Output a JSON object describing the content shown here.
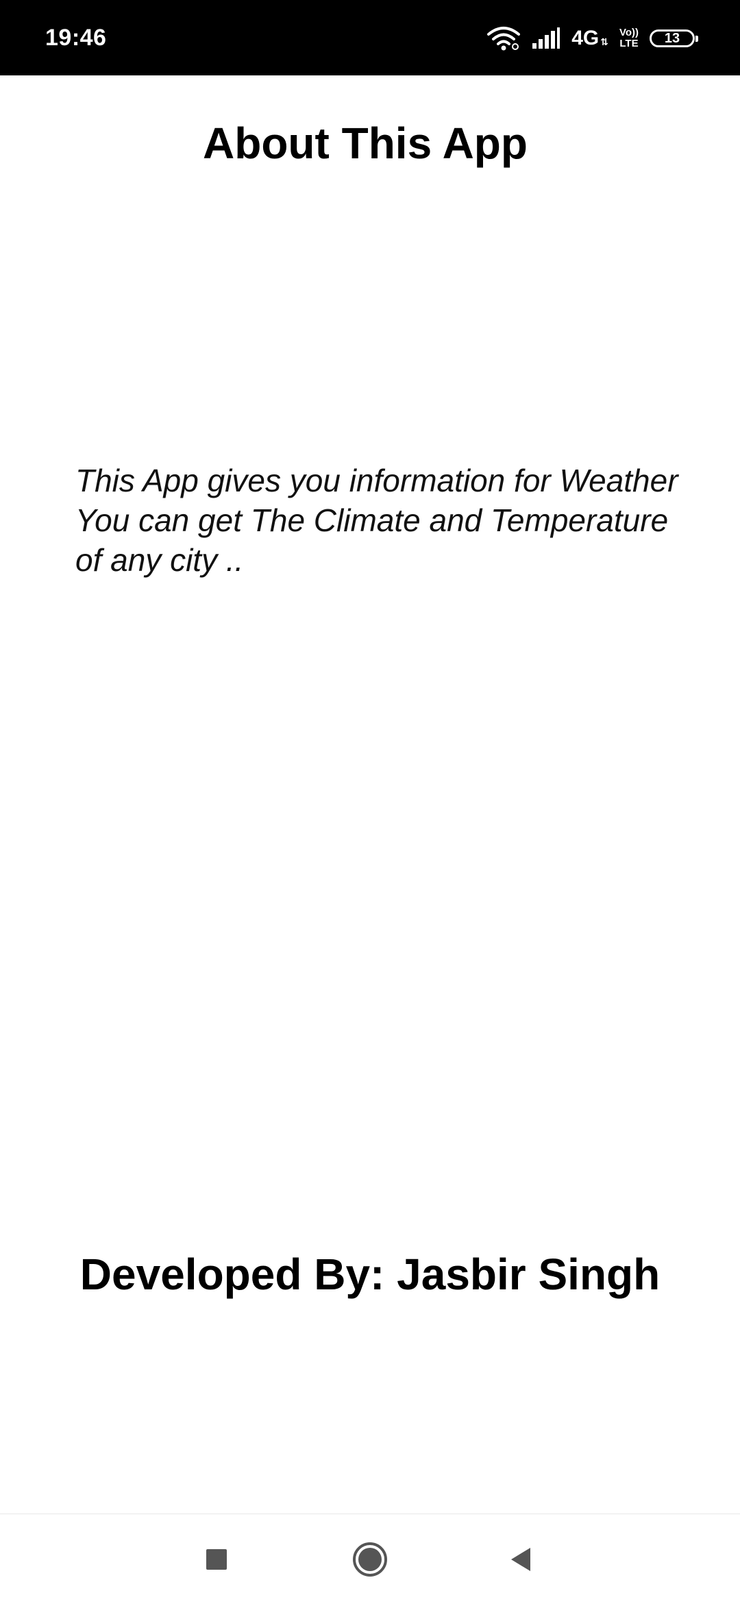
{
  "status_bar": {
    "time": "19:46",
    "network_type": "4G",
    "volte_top": "Vo))",
    "volte_bottom": "LTE",
    "battery_level": "13",
    "icons": [
      "wifi-icon",
      "signal-icon",
      "battery-icon"
    ]
  },
  "about": {
    "title": "About This App",
    "description": "This App gives you information for Weather You can get The Climate and Temperature of any city ..",
    "developer": "Developed By: Jasbir Singh"
  },
  "nav_bar": {
    "icons": [
      "recents-icon",
      "home-icon",
      "back-icon"
    ]
  },
  "colors": {
    "status_bar_bg": "#000000",
    "page_bg": "#ffffff",
    "text": "#000000",
    "nav_icon": "#555555"
  }
}
